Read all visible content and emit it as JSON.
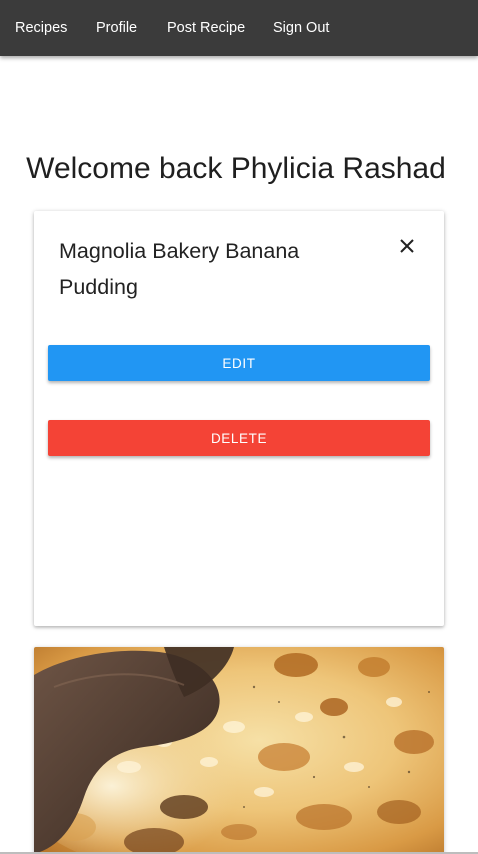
{
  "nav": {
    "links": [
      {
        "label": "Recipes"
      },
      {
        "label": "Profile"
      },
      {
        "label": "Post Recipe"
      },
      {
        "label": "Sign Out"
      }
    ]
  },
  "welcome": {
    "text": "Welcome back Phylicia Rashad"
  },
  "recipe_card": {
    "title": "Magnolia Bakery Banana Pudding",
    "close_icon": "close-icon",
    "edit_label": "EDIT",
    "delete_label": "DELETE"
  },
  "image_card": {
    "image": "macaroni-and-cheese-photo"
  },
  "colors": {
    "navbar": "#3b3b3b",
    "edit": "#2196f3",
    "delete": "#f44336",
    "nav_text": "#ffffff"
  }
}
